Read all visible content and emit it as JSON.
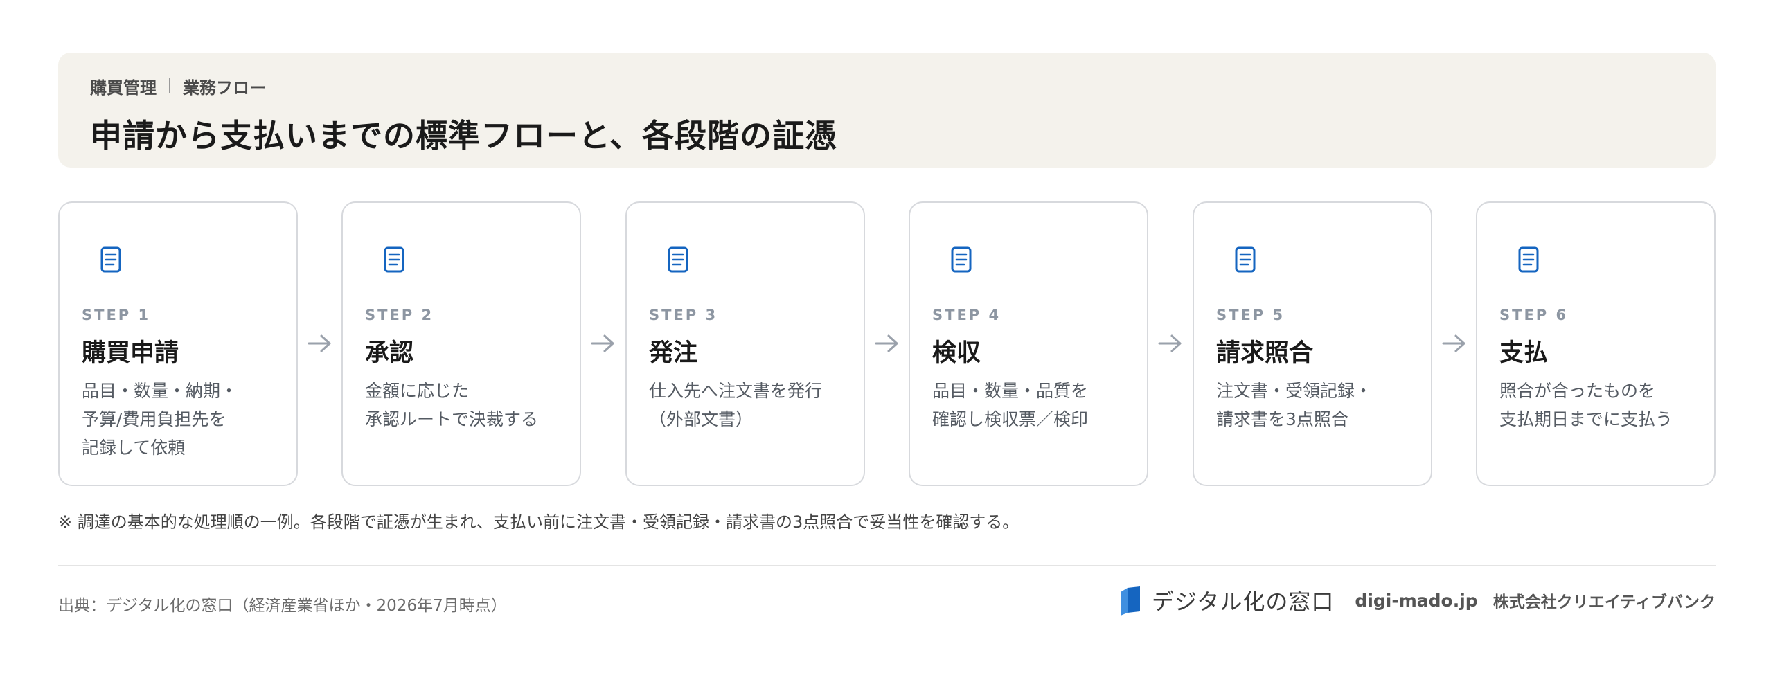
{
  "header": {
    "breadcrumb": [
      "購買管理",
      "業務フロー"
    ],
    "title": "申請から支払いまでの標準フローと、各段階の証憑"
  },
  "steps": [
    {
      "step": "STEP 1",
      "name": "購買申請",
      "desc": [
        "品目・数量・納期・",
        "予算/費用負担先を",
        "記録して依頼"
      ]
    },
    {
      "step": "STEP 2",
      "name": "承認",
      "desc": [
        "金額に応じた",
        "承認ルートで決裁する"
      ]
    },
    {
      "step": "STEP 3",
      "name": "発注",
      "desc": [
        "仕入先へ注文書を発行",
        "（外部文書）"
      ]
    },
    {
      "step": "STEP 4",
      "name": "検収",
      "desc": [
        "品目・数量・品質を",
        "確認し検収票／検印"
      ]
    },
    {
      "step": "STEP 5",
      "name": "請求照合",
      "desc": [
        "注文書・受領記録・",
        "請求書を3点照合"
      ]
    },
    {
      "step": "STEP 6",
      "name": "支払",
      "desc": [
        "照合が合ったものを",
        "支払期日までに支払う"
      ]
    }
  ],
  "icons": {
    "step": "document-icon",
    "connector": "arrow-right-icon"
  },
  "note": "※ 調達の基本的な処理順の一例。各段階で証憑が生まれ、支払い前に注文書・受領記録・請求書の3点照合で妥当性を確認する。",
  "footer": {
    "source": "出典：デジタル化の窓口（経済産業省ほか・2026年7月時点）",
    "logo_text": "デジタル化の窓口",
    "domain": "digi-mado.jp",
    "company": "株式会社クリエイティブバンク"
  },
  "colors": {
    "accent": "#1565c0",
    "header_bg": "#f4f2ec",
    "step_label": "#8d96a2",
    "card_border": "#d7d9dd"
  }
}
